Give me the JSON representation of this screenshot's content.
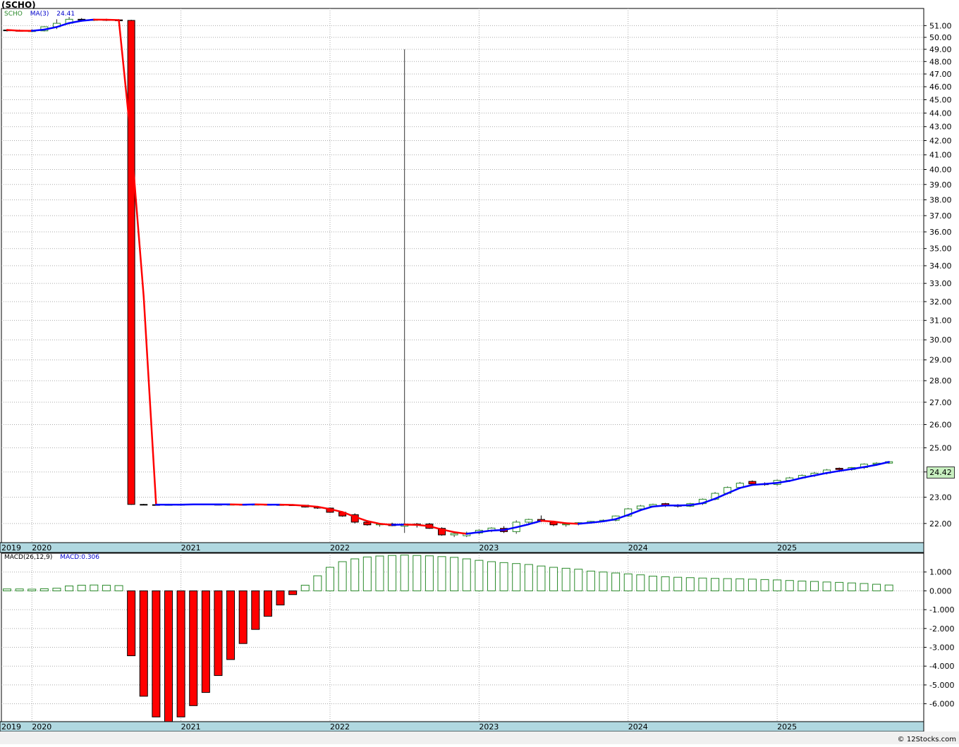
{
  "header": {
    "title": "(SCHO)",
    "legend_symbol": "SCHO",
    "legend_ma_label": "MA(3)",
    "legend_ma_value": "24.41",
    "price_tag": "24.42",
    "macd_label": "MACD(26,12,9)",
    "macd_value": "MACD:0.306",
    "credit": "© 12Stocks.com"
  },
  "colors": {
    "up_candle": "#2a8a2a",
    "down_candle": "#ff0000",
    "ma_up": "#0000ff",
    "ma_down": "#ff0000",
    "axis_band": "#b0d8e0",
    "grid": "#aaaaaa"
  },
  "chart_data": [
    {
      "type": "candlestick",
      "title": "(SCHO)",
      "series_names": [
        "SCHO",
        "MA(3)"
      ],
      "x_tick_labels": [
        "2019",
        "2020",
        "2021",
        "2022",
        "2023",
        "2024",
        "2025"
      ],
      "y_tick_labels": [
        "22.00",
        "23.00",
        "24.00",
        "25.00",
        "26.00",
        "27.00",
        "28.00",
        "29.00",
        "30.00",
        "31.00",
        "32.00",
        "33.00",
        "34.00",
        "35.00",
        "36.00",
        "37.00",
        "38.00",
        "39.00",
        "40.00",
        "41.00",
        "42.00",
        "43.00",
        "44.00",
        "45.00",
        "46.00",
        "47.00",
        "48.00",
        "49.00",
        "50.00",
        "51.00"
      ],
      "y_ticks": [
        22,
        23,
        24,
        25,
        26,
        27,
        28,
        29,
        30,
        31,
        32,
        33,
        34,
        35,
        36,
        37,
        38,
        39,
        40,
        41,
        42,
        43,
        44,
        45,
        46,
        47,
        48,
        49,
        50,
        51
      ],
      "ylim": [
        21.3,
        52.5
      ],
      "y_scale": "log",
      "grid": true,
      "last_price": 24.42,
      "ma_last": 24.41,
      "months": [
        "2019-11",
        "2019-12",
        "2020-01",
        "2020-02",
        "2020-03",
        "2020-04",
        "2020-05",
        "2020-06",
        "2020-07",
        "2020-08",
        "2020-09",
        "2020-10",
        "2020-11",
        "2020-12",
        "2021-01",
        "2021-02",
        "2021-03",
        "2021-04",
        "2021-05",
        "2021-06",
        "2021-07",
        "2021-08",
        "2021-09",
        "2021-10",
        "2021-11",
        "2021-12",
        "2022-01",
        "2022-02",
        "2022-03",
        "2022-04",
        "2022-05",
        "2022-06",
        "2022-07",
        "2022-08",
        "2022-09",
        "2022-10",
        "2022-11",
        "2022-12",
        "2023-01",
        "2023-02",
        "2023-03",
        "2023-04",
        "2023-05",
        "2023-06",
        "2023-07",
        "2023-08",
        "2023-09",
        "2023-10",
        "2023-11",
        "2023-12",
        "2024-01",
        "2024-02",
        "2024-03",
        "2024-04",
        "2024-05",
        "2024-06",
        "2024-07",
        "2024-08",
        "2024-09",
        "2024-10",
        "2024-11",
        "2024-12",
        "2025-01",
        "2025-02",
        "2025-03",
        "2025-04",
        "2025-05",
        "2025-06",
        "2025-07",
        "2025-08",
        "2025-09",
        "2025-10"
      ],
      "ohlc": [
        [
          50.62,
          50.7,
          50.5,
          50.6
        ],
        [
          50.6,
          50.66,
          50.48,
          50.52
        ],
        [
          50.52,
          50.7,
          50.45,
          50.55
        ],
        [
          50.55,
          50.95,
          50.5,
          50.9
        ],
        [
          50.9,
          51.55,
          50.7,
          51.2
        ],
        [
          51.2,
          51.75,
          51.1,
          51.55
        ],
        [
          51.55,
          51.65,
          51.4,
          51.5
        ],
        [
          51.5,
          51.6,
          51.4,
          51.52
        ],
        [
          51.52,
          51.6,
          51.4,
          51.5
        ],
        [
          51.5,
          51.56,
          51.4,
          51.42
        ],
        [
          51.45,
          51.5,
          22.7,
          22.72
        ],
        [
          22.72,
          22.74,
          22.7,
          22.71
        ],
        [
          22.71,
          22.73,
          22.69,
          22.7
        ],
        [
          22.7,
          22.72,
          22.68,
          22.71
        ],
        [
          22.71,
          22.74,
          22.69,
          22.72
        ],
        [
          22.72,
          22.74,
          22.7,
          22.73
        ],
        [
          22.73,
          22.75,
          22.7,
          22.72
        ],
        [
          22.72,
          22.74,
          22.7,
          22.71
        ],
        [
          22.71,
          22.74,
          22.69,
          22.72
        ],
        [
          22.72,
          22.74,
          22.7,
          22.71
        ],
        [
          22.71,
          22.73,
          22.69,
          22.72
        ],
        [
          22.72,
          22.74,
          22.7,
          22.71
        ],
        [
          22.71,
          22.73,
          22.69,
          22.7
        ],
        [
          22.7,
          22.72,
          22.68,
          22.69
        ],
        [
          22.69,
          22.7,
          22.6,
          22.62
        ],
        [
          22.62,
          22.64,
          22.55,
          22.58
        ],
        [
          22.58,
          22.6,
          22.4,
          22.42
        ],
        [
          22.42,
          22.44,
          22.25,
          22.28
        ],
        [
          22.33,
          22.38,
          22.0,
          22.05
        ],
        [
          22.05,
          22.08,
          21.92,
          21.95
        ],
        [
          21.95,
          22.02,
          21.88,
          21.98
        ],
        [
          21.98,
          22.03,
          21.9,
          21.92
        ],
        [
          21.9,
          49.0,
          21.65,
          21.98
        ],
        [
          21.98,
          22.02,
          21.85,
          21.95
        ],
        [
          21.98,
          22.02,
          21.8,
          21.82
        ],
        [
          21.82,
          21.86,
          21.55,
          21.58
        ],
        [
          21.58,
          21.66,
          21.5,
          21.63
        ],
        [
          21.55,
          21.7,
          21.5,
          21.65
        ],
        [
          21.65,
          21.78,
          21.6,
          21.75
        ],
        [
          21.75,
          21.86,
          21.68,
          21.83
        ],
        [
          21.82,
          21.9,
          21.65,
          21.7
        ],
        [
          21.7,
          22.12,
          21.62,
          22.05
        ],
        [
          22.05,
          22.18,
          21.95,
          22.15
        ],
        [
          22.15,
          22.3,
          22.05,
          22.1
        ],
        [
          22.05,
          22.1,
          21.9,
          21.95
        ],
        [
          21.95,
          22.0,
          21.88,
          21.98
        ],
        [
          21.98,
          22.05,
          21.93,
          22.03
        ],
        [
          22.03,
          22.1,
          22.0,
          22.08
        ],
        [
          22.08,
          22.15,
          22.05,
          22.12
        ],
        [
          22.12,
          22.3,
          22.08,
          22.28
        ],
        [
          22.28,
          22.58,
          22.25,
          22.55
        ],
        [
          22.55,
          22.7,
          22.5,
          22.66
        ],
        [
          22.66,
          22.75,
          22.6,
          22.72
        ],
        [
          22.75,
          22.78,
          22.62,
          22.66
        ],
        [
          22.68,
          22.73,
          22.6,
          22.65
        ],
        [
          22.65,
          22.78,
          22.62,
          22.75
        ],
        [
          22.75,
          22.95,
          22.7,
          22.92
        ],
        [
          22.92,
          23.2,
          22.88,
          23.15
        ],
        [
          23.15,
          23.42,
          23.1,
          23.38
        ],
        [
          23.38,
          23.6,
          23.32,
          23.55
        ],
        [
          23.62,
          23.66,
          23.48,
          23.52
        ],
        [
          23.52,
          23.58,
          23.45,
          23.5
        ],
        [
          23.5,
          23.7,
          23.45,
          23.66
        ],
        [
          23.66,
          23.8,
          23.6,
          23.76
        ],
        [
          23.76,
          23.9,
          23.72,
          23.86
        ],
        [
          23.86,
          24.0,
          23.8,
          23.95
        ],
        [
          23.95,
          24.12,
          23.9,
          24.08
        ],
        [
          24.15,
          24.18,
          24.04,
          24.1
        ],
        [
          24.1,
          24.2,
          24.05,
          24.18
        ],
        [
          24.18,
          24.35,
          24.12,
          24.32
        ],
        [
          24.32,
          24.4,
          24.28,
          24.36
        ],
        [
          24.36,
          24.44,
          24.33,
          24.42
        ]
      ],
      "ma3": [
        50.63,
        50.56,
        50.55,
        50.66,
        50.88,
        51.22,
        51.42,
        51.52,
        51.51,
        51.48,
        41.88,
        32.28,
        22.71,
        22.71,
        22.71,
        22.72,
        22.72,
        22.72,
        22.72,
        22.71,
        22.72,
        22.71,
        22.71,
        22.7,
        22.67,
        22.63,
        22.54,
        22.43,
        22.25,
        22.09,
        21.99,
        21.95,
        21.96,
        21.95,
        21.9,
        21.78,
        21.68,
        21.62,
        21.68,
        21.74,
        21.76,
        21.86,
        21.97,
        22.1,
        22.07,
        22.01,
        21.99,
        22.03,
        22.08,
        22.16,
        22.32,
        22.5,
        22.64,
        22.68,
        22.68,
        22.69,
        22.77,
        22.94,
        23.15,
        23.36,
        23.48,
        23.52,
        23.56,
        23.64,
        23.76,
        23.86,
        23.96,
        24.04,
        24.12,
        24.2,
        24.29,
        24.41
      ]
    },
    {
      "type": "bar",
      "title": "MACD(26,12,9)",
      "last_value": 0.306,
      "y_tick_labels": [
        "1.000",
        "0.000",
        "-1.000",
        "-2.000",
        "-3.000",
        "-4.000",
        "-5.000",
        "-6.000"
      ],
      "y_ticks": [
        1,
        0,
        -1,
        -2,
        -3,
        -4,
        -5,
        -6
      ],
      "ylim": [
        -6.95,
        2.0
      ],
      "x_tick_labels": [
        "2019",
        "2020",
        "2021",
        "2022",
        "2023",
        "2024",
        "2025"
      ],
      "values": [
        0.1,
        0.1,
        0.09,
        0.11,
        0.14,
        0.26,
        0.3,
        0.31,
        0.3,
        0.28,
        -3.45,
        -5.6,
        -6.7,
        -6.95,
        -6.7,
        -6.1,
        -5.4,
        -4.5,
        -3.65,
        -2.8,
        -2.05,
        -1.35,
        -0.75,
        -0.2,
        0.3,
        0.8,
        1.25,
        1.55,
        1.7,
        1.8,
        1.85,
        1.88,
        1.9,
        1.88,
        1.86,
        1.82,
        1.78,
        1.7,
        1.62,
        1.55,
        1.5,
        1.45,
        1.4,
        1.32,
        1.25,
        1.2,
        1.15,
        1.05,
        1.0,
        0.95,
        0.9,
        0.85,
        0.78,
        0.75,
        0.72,
        0.7,
        0.68,
        0.66,
        0.65,
        0.64,
        0.62,
        0.6,
        0.58,
        0.55,
        0.52,
        0.5,
        0.47,
        0.45,
        0.42,
        0.39,
        0.35,
        0.31
      ]
    }
  ]
}
